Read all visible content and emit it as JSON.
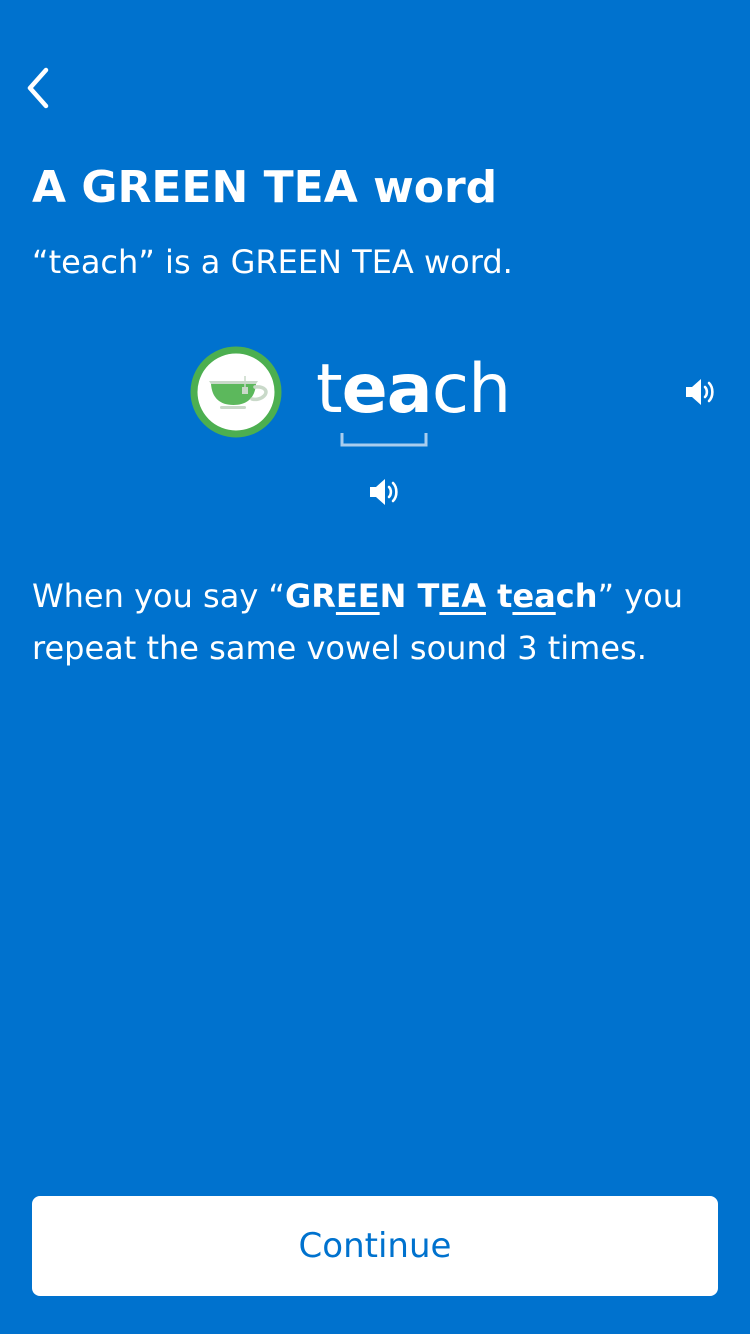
{
  "header": {
    "back_icon": "chevron-left-icon"
  },
  "page": {
    "title": "A GREEN TEA word",
    "subtitle": "“teach” is a GREEN TEA word."
  },
  "word_card": {
    "badge_icon": "green-tea-cup-icon",
    "word_parts": [
      "t",
      "ea",
      "ch"
    ],
    "bracket_icon": "vowel-bracket-icon",
    "speaker_icon": "speaker-icon"
  },
  "explanation": {
    "prefix": "When you say “",
    "bold_1a": "GR",
    "underline_1": "EE",
    "bold_1b": "N T",
    "underline_2": "EA",
    "bold_2a": "t",
    "underline_3": "ea",
    "bold_2b": "ch",
    "suffix": "” you repeat the same vowel sound 3 times."
  },
  "footer": {
    "continue_label": "Continue"
  },
  "colors": {
    "background": "#0072CE",
    "text": "#FFFFFF",
    "badge_ring": "#4CAF50",
    "badge_cup": "#5CB85C",
    "button_text": "#0072CE"
  }
}
